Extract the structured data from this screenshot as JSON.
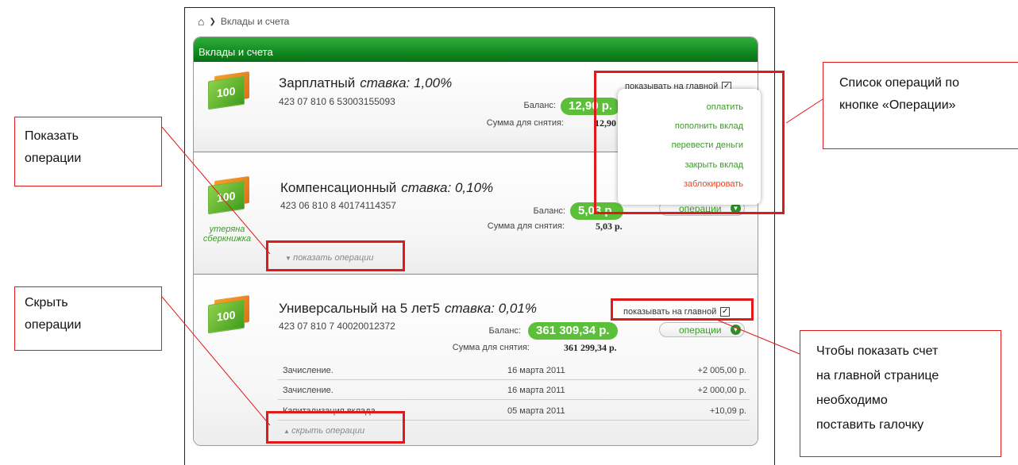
{
  "breadcrumb": {
    "current": "Вклады и счета"
  },
  "panel": {
    "title": "Вклады и счета"
  },
  "labels": {
    "balance": "Баланс:",
    "withdraw": "Сумма для снятия:",
    "show_on_main": "показывать на главной",
    "operations": "операции"
  },
  "accounts": [
    {
      "name": "Зарплатный",
      "rate": "ставка: 1,00%",
      "number": "423 07 810 6 53003155093",
      "balance": "12,90 р.",
      "withdraw": "12,90 р."
    },
    {
      "name": "Компенсационный",
      "rate": "ставка: 0,10%",
      "number": "423 06 810 8 40174114357",
      "balance": "5,03 р.",
      "withdraw": "5,03 р.",
      "lost_line1": "утеряна",
      "lost_line2": "сберкнижка",
      "toggle": "показать операции"
    },
    {
      "name": "Универсальный на 5 лет5",
      "rate": "ставка: 0,01%",
      "number": "423 07 810 7 40020012372",
      "balance": "361 309,34 р.",
      "withdraw": "361 299,34 р.",
      "toggle": "скрыть операции",
      "transactions": [
        {
          "desc": "Зачисление.",
          "date": "16 марта 2011",
          "amount": "+2 005,00 р."
        },
        {
          "desc": "Зачисление.",
          "date": "16 марта 2011",
          "amount": "+2 000,00 р."
        },
        {
          "desc": "Капитализация вклада.",
          "date": "05 марта 2011",
          "amount": "+10,09 р."
        }
      ]
    }
  ],
  "dropdown": {
    "items": [
      "оплатить",
      "пополнить вклад",
      "перевести деньги",
      "закрыть вклад",
      "заблокировать"
    ]
  },
  "annotations": {
    "show_ops": [
      "Показать",
      "операции"
    ],
    "hide_ops": [
      "Скрыть",
      "операции"
    ],
    "ops_list": [
      "Список операций по",
      "кнопке «Операции»"
    ],
    "checkbox_hint": [
      "Чтобы показать счет",
      "на главной странице",
      "необходимо",
      "поставить галочку"
    ]
  },
  "colors": {
    "header_green": "#138a21",
    "pill_green": "#5cbf3a",
    "link_green": "#3d9a2a",
    "alert_red": "#e04a2a",
    "annotation_red": "#e01a1a"
  }
}
